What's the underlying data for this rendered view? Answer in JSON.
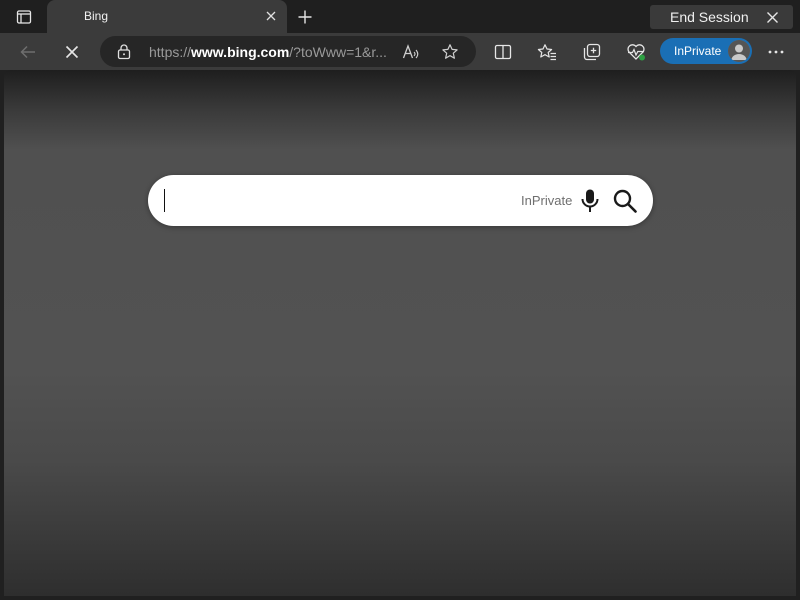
{
  "tabstrip": {
    "tab_title": "Bing",
    "end_session_label": "End Session"
  },
  "toolbar": {
    "url_prefix": "https://",
    "url_domain": "www.bing.com",
    "url_suffix": "/?toWww=1&r...",
    "inprivate_label": "InPrivate",
    "accent_color": "#1a6fb5"
  },
  "page": {
    "search_placeholder": "",
    "search_inprivate_label": "InPrivate"
  },
  "icons": {
    "tab_actions": "tab-actions-icon",
    "tab_close": "close-icon",
    "new_tab": "plus-icon",
    "end_session_close": "close-icon",
    "back": "arrow-left-icon",
    "stop": "stop-icon",
    "lock": "lock-icon",
    "read_aloud": "read-aloud-icon",
    "add_favorite": "star-icon",
    "split_screen": "split-screen-icon",
    "favorites": "favorites-icon",
    "collections": "collections-icon",
    "browser_essentials": "heart-pulse-icon",
    "avatar": "avatar-icon",
    "more": "more-icon",
    "mic": "microphone-icon",
    "search": "search-icon"
  }
}
